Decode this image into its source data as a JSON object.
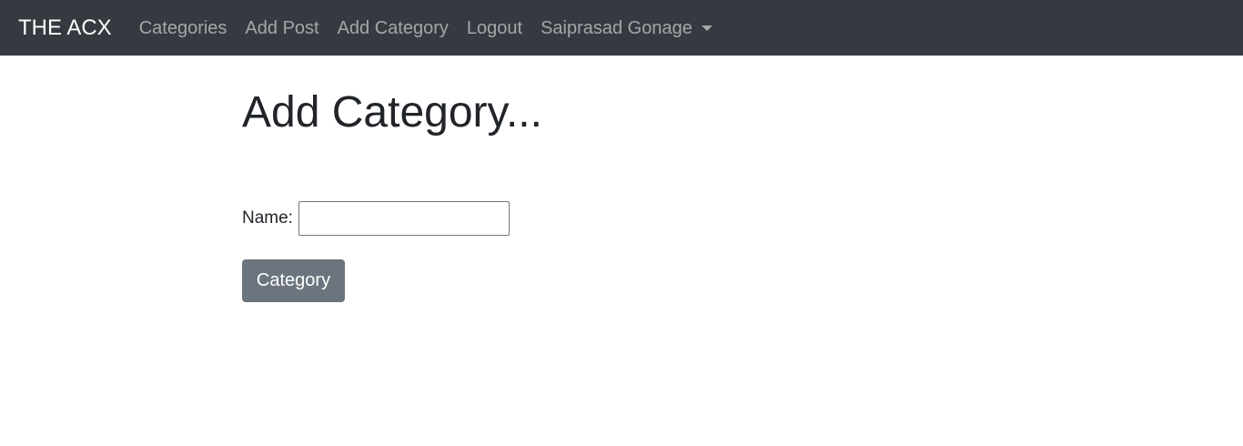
{
  "navbar": {
    "brand": "THE ACX",
    "links": [
      {
        "label": "Categories"
      },
      {
        "label": "Add Post"
      },
      {
        "label": "Add Category"
      },
      {
        "label": "Logout"
      },
      {
        "label": "Saiprasad Gonage"
      }
    ],
    "background": "#343a40"
  },
  "main": {
    "title": "Add Category...",
    "form": {
      "name_label": "Name:",
      "name_value": "",
      "submit_label": "Category"
    },
    "button_color": "#6c757d"
  }
}
